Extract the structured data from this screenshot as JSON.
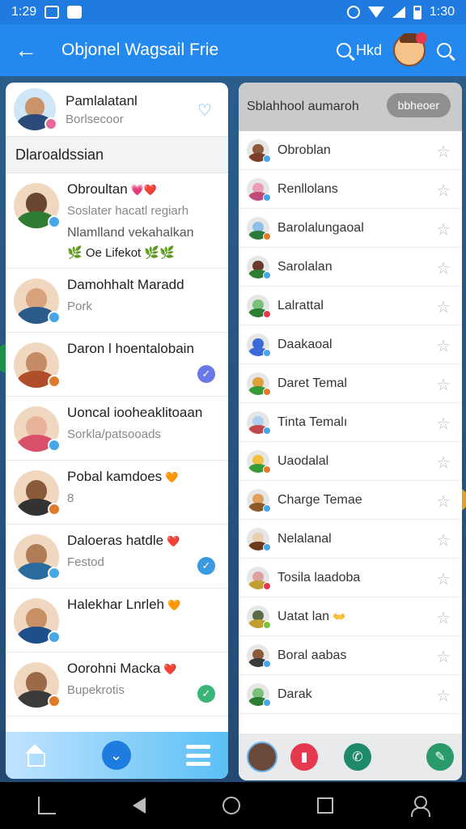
{
  "status_bar": {
    "time": "1:29",
    "right_time": "1:30"
  },
  "app_bar": {
    "title": "Objonel Wagsail Frie",
    "search_label": "Hkd"
  },
  "profile": {
    "name": "Pamlalatanl",
    "subtitle": "Borlsecoor"
  },
  "section_title": "Dlaroaldssian",
  "chats": [
    {
      "name": "Obroultan",
      "emoji": "💗❤️",
      "message": "Soslater hacatl regiarh",
      "name2": "Nlamlland vekahalkan",
      "message2": "🌿 Oe Lifekot 🌿🌿",
      "skin": "#6a4630",
      "shirt": "#2e7d32",
      "badge": "#45a6e8"
    },
    {
      "name": "Damohhalt Maradd",
      "emoji": "",
      "message": "Pork",
      "skin": "#d7a27c",
      "shirt": "#2a5b8a",
      "badge": "#45a6e8"
    },
    {
      "name": "Daron l hoentalobain",
      "emoji": "",
      "message": "",
      "skin": "#c58b64",
      "shirt": "#b04e2a",
      "badge": "#e07b2a",
      "check": "#6a78e8"
    },
    {
      "name": "Uoncal iooheaklitoaan",
      "emoji": "",
      "message": "Sorkla/patsooads",
      "skin": "#e7b39a",
      "shirt": "#d8506a",
      "badge": "#45a6e8"
    },
    {
      "name": "Pobal kamdoes",
      "emoji": "🧡",
      "message": "8",
      "skin": "#8b5a3a",
      "shirt": "#333333",
      "badge": "#e07b2a"
    },
    {
      "name": "Daloeras hatdle",
      "emoji": "❤️",
      "message": "Festod",
      "skin": "#b07c55",
      "shirt": "#2a6ba0",
      "badge": "#45a6e8",
      "check": "#3a9ae0"
    },
    {
      "name": "Halekhar Lnrleh",
      "emoji": "🧡",
      "message": "",
      "skin": "#c98f66",
      "shirt": "#1e4f8a",
      "badge": "#45a6e8"
    },
    {
      "name": "Oorohni Macka",
      "emoji": "❤️",
      "message": "Bupekrotis",
      "skin": "#9b6a48",
      "shirt": "#3b3b3b",
      "badge": "#e07b2a",
      "check": "#3ab57a"
    }
  ],
  "right_search": {
    "text": "Sblahhool aumaroh",
    "pill": "bbheoer"
  },
  "contacts": [
    {
      "name": "Obroblan",
      "emoji": "",
      "skin": "#8b5a3a",
      "shirt": "#7b3f2a",
      "badge": "#45a6e8"
    },
    {
      "name": "Renllolans",
      "emoji": "",
      "skin": "#e8a0b8",
      "shirt": "#c04a7a",
      "badge": "#45a6e8"
    },
    {
      "name": "Barolalungaoal",
      "emoji": "",
      "skin": "#8fc1e8",
      "shirt": "#2c7a3a",
      "badge": "#e07b2a"
    },
    {
      "name": "Sarolalan",
      "emoji": "",
      "skin": "#6a3a2a",
      "shirt": "#2e7d32",
      "badge": "#45a6e8"
    },
    {
      "name": "Lalrattal",
      "emoji": "",
      "skin": "#7ac07a",
      "shirt": "#2e7d32",
      "badge": "#e53950"
    },
    {
      "name": "Daakaoal",
      "emoji": "",
      "skin": "#3a6ad8",
      "shirt": "#3a6ad8",
      "badge": "#45a6e8"
    },
    {
      "name": "Daret Temal",
      "emoji": "",
      "skin": "#e0a040",
      "shirt": "#3a9a3a",
      "badge": "#e07b2a"
    },
    {
      "name": "Tinta Temalı",
      "emoji": "",
      "skin": "#b0d0f0",
      "shirt": "#c04a4a",
      "badge": "#45a6e8"
    },
    {
      "name": "Uaodalal",
      "emoji": "",
      "skin": "#f0c040",
      "shirt": "#3a9a3a",
      "badge": "#e07b2a"
    },
    {
      "name": "Charge Temae",
      "emoji": "",
      "skin": "#e0a060",
      "shirt": "#8a5a2a",
      "badge": "#45a6e8"
    },
    {
      "name": "Nelalanal",
      "emoji": "",
      "skin": "#e8d0b0",
      "shirt": "#6a3a1a",
      "badge": "#45a6e8"
    },
    {
      "name": "Tosila laadoba",
      "emoji": "",
      "skin": "#e0a0a0",
      "shirt": "#c0a030",
      "badge": "#e53950"
    },
    {
      "name": "Uatat lan",
      "emoji": "👐",
      "skin": "#5a6a4a",
      "shirt": "#c0a030",
      "badge": "#7ac040"
    },
    {
      "name": "Boral aabas",
      "emoji": "",
      "skin": "#8a5a3a",
      "shirt": "#3a3a3a",
      "badge": "#45a6e8"
    },
    {
      "name": "Darak",
      "emoji": "",
      "skin": "#7ac07a",
      "shirt": "#2e7d32",
      "badge": "#45a6e8"
    }
  ],
  "colors": {
    "accent": "#2389ee",
    "right_btn_green": "#2a9a6a",
    "right_btn_red": "#e53950"
  }
}
